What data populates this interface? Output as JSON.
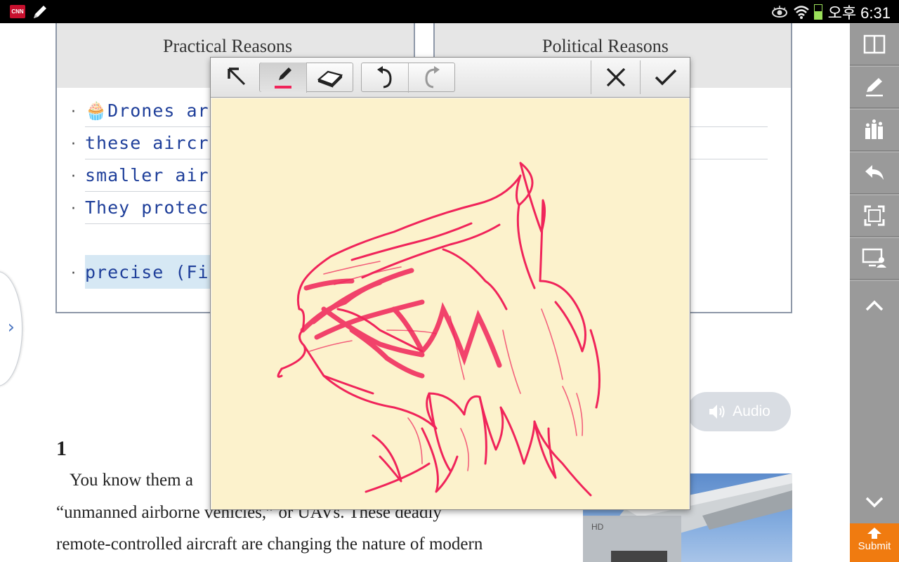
{
  "status_bar": {
    "left_icons": [
      "cnn-icon",
      "pen-icon"
    ],
    "right_icons": [
      "eye-icon",
      "wifi-icon",
      "battery-icon"
    ],
    "time": "오후 6:31",
    "cnn_label": "CNN"
  },
  "table": {
    "left_header": "Practical Reasons",
    "right_header": "Political Reasons",
    "rows": [
      {
        "text": "🧁Drones are c"
      },
      {
        "text": "these aircraft"
      },
      {
        "text": "smaller aircrat"
      },
      {
        "text": "They protect p"
      },
      {
        "text": "precise (Finally"
      }
    ],
    "bullet": "·"
  },
  "side_tab": {
    "chevron": "›"
  },
  "audio": {
    "label": "Audio",
    "icon": "speaker-icon"
  },
  "article": {
    "number": "1",
    "lines": [
      "You know them a",
      "“unmanned airborne vehicles,” or UAVs. These deadly",
      "remote-controlled aircraft are changing the nature of modern"
    ]
  },
  "right_toolbar": {
    "items": [
      "layout-icon",
      "pencil-icon",
      "chart-icon",
      "undo-icon",
      "fullscreen-icon",
      "screen-share-icon",
      "scroll-up-icon",
      "scroll-down-icon"
    ],
    "submit_label": "Submit"
  },
  "drawing_popup": {
    "tools": [
      "select-arrow-icon",
      "pen-icon",
      "eraser-icon",
      "undo-icon",
      "redo-icon",
      "close-icon",
      "confirm-icon"
    ],
    "active_tool": "pen",
    "pen_color": "#f0245a",
    "canvas_color": "#fcf2cc",
    "content": "red sketch of a pony head"
  },
  "colors": {
    "toolbar": "#9a9a9a",
    "submit": "#f07b10",
    "handwriting": "#1f3f9a",
    "table_border": "#8e98a8"
  }
}
